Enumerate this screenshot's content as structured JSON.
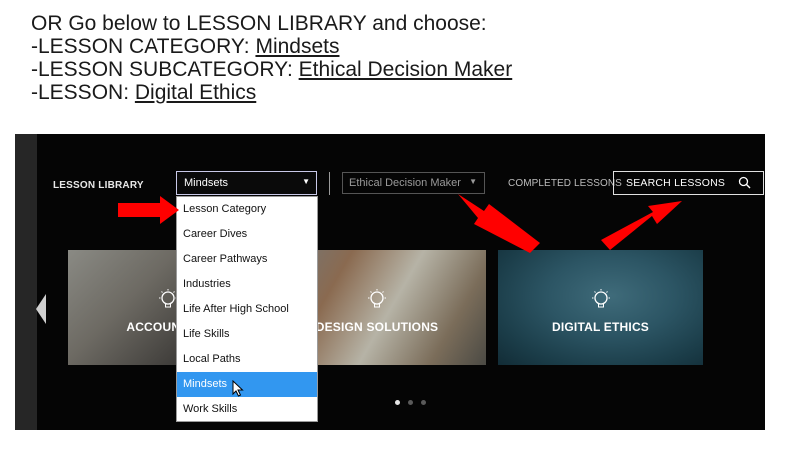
{
  "instructions": {
    "line1": "OR Go below to LESSON LIBRARY and choose:",
    "line2_label": "-LESSON CATEGORY: ",
    "line2_value": "Mindsets ",
    "line3_label": "-LESSON SUBCATEGORY: ",
    "line3_value": "Ethical Decision Maker",
    "line4_label": "-LESSON: ",
    "line4_value": "Digital Ethics"
  },
  "toolbar": {
    "library_label": "LESSON LIBRARY",
    "category_value": "Mindsets",
    "subcategory_value": "Ethical Decision Maker",
    "completed_label": "COMPLETED LESSONS",
    "search_label": "SEARCH LESSONS"
  },
  "dropdown": {
    "options": [
      "Lesson Category",
      "Career Dives",
      "Career Pathways",
      "Industries",
      "Life After High School",
      "Life Skills",
      "Local Paths",
      "Mindsets",
      "Work Skills"
    ],
    "selected": "Mindsets"
  },
  "cards": [
    {
      "title": "ACCOUNTING"
    },
    {
      "title": "DESIGN SOLUTIONS"
    },
    {
      "title": "DIGITAL ETHICS"
    }
  ],
  "carousel": {
    "pages": 3,
    "active_page": 1
  },
  "colors": {
    "annotation_arrow": "#ff0000",
    "selected_option": "#3297f0",
    "panel_background": "#050505"
  },
  "icons": [
    "chevron-down-icon",
    "search-icon",
    "lightbulb-icon",
    "chevron-left-icon",
    "pointer-cursor-icon",
    "red-arrow-icon"
  ]
}
